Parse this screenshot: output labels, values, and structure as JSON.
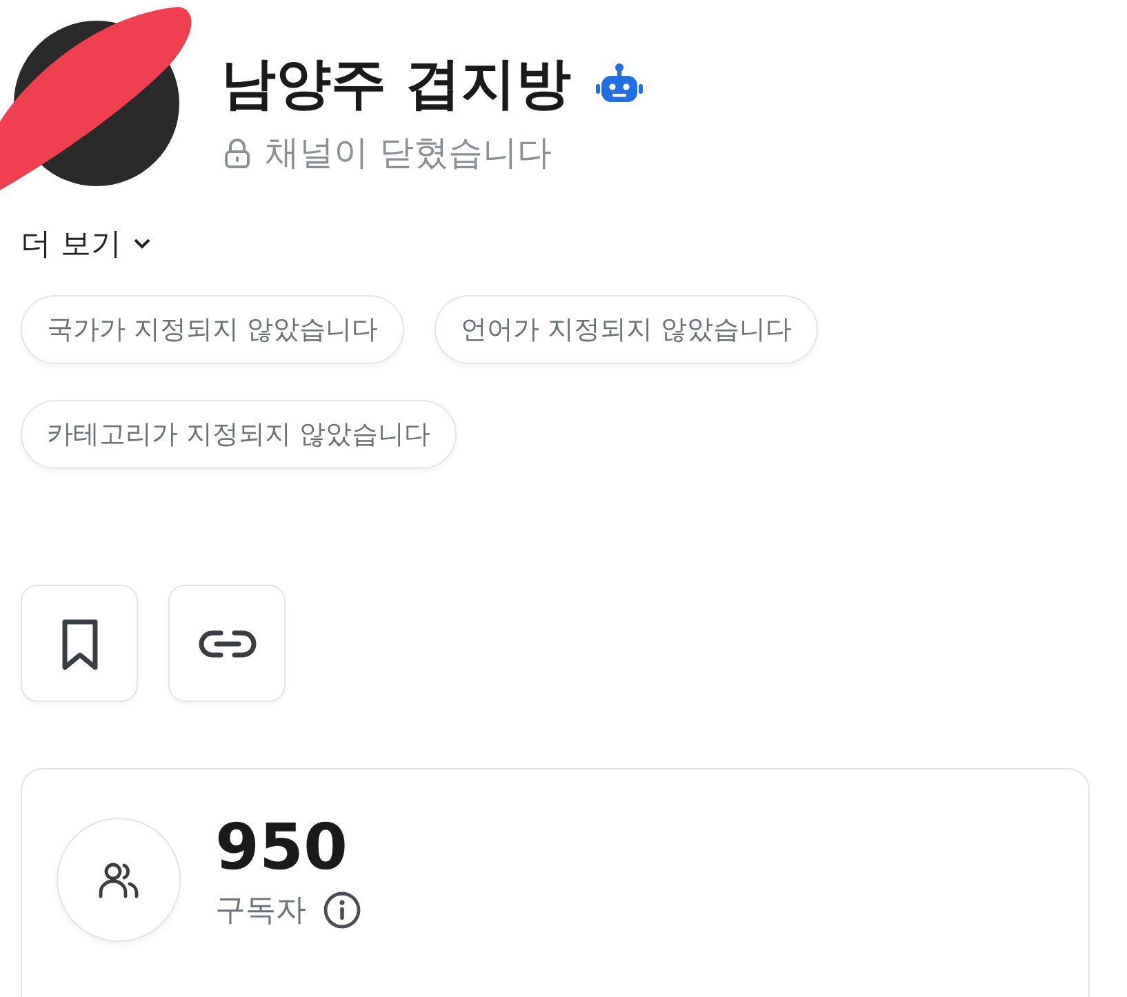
{
  "channel": {
    "name": "남양주 겹지방",
    "bot": true,
    "closed": true,
    "status": "채널이 닫혔습니다"
  },
  "more": {
    "label": "더 보기",
    "expanded": false
  },
  "tags": [
    {
      "label": "국가가 지정되지 않았습니다"
    },
    {
      "label": "언어가 지정되지 않았습니다"
    },
    {
      "label": "카테고리가 지정되지 않았습니다"
    }
  ],
  "stats": {
    "value": "950",
    "label": "구독자"
  }
}
